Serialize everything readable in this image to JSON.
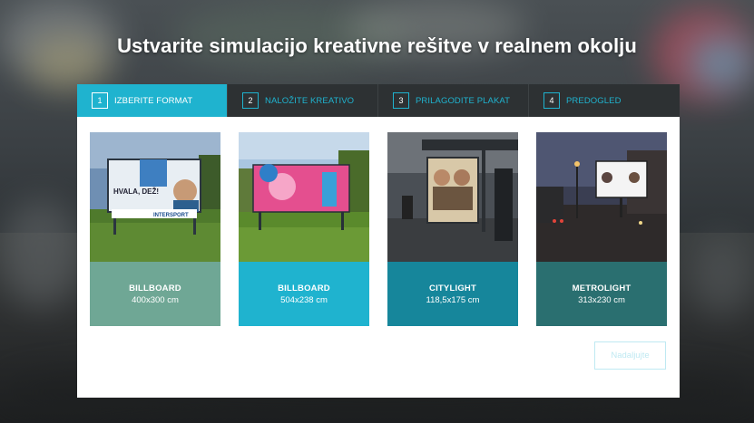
{
  "page": {
    "title": "Ustvarite simulacijo kreativne rešitve v realnem okolju"
  },
  "steps": [
    {
      "num": "1",
      "label": "IZBERITE FORMAT",
      "active": true
    },
    {
      "num": "2",
      "label": "NALOŽITE KREATIVO",
      "active": false
    },
    {
      "num": "3",
      "label": "PRILAGODITE PLAKAT",
      "active": false
    },
    {
      "num": "4",
      "label": "PREDOGLED",
      "active": false
    }
  ],
  "formats": [
    {
      "name": "BILLBOARD",
      "size": "400x300 cm",
      "color": "#6fa795",
      "poster_text": "HVALA, DEŽ!",
      "brand_text": "INTERSPORT"
    },
    {
      "name": "BILLBOARD",
      "size": "504x238 cm",
      "color": "#1fb3cf"
    },
    {
      "name": "CITYLIGHT",
      "size": "118,5x175 cm",
      "color": "#16869b"
    },
    {
      "name": "METROLIGHT",
      "size": "313x230 cm",
      "color": "#2a6f70"
    }
  ],
  "next_button": {
    "label": "Nadaljujte"
  },
  "colors": {
    "accent": "#1fb3cf",
    "step_bar": "#2d3133"
  }
}
